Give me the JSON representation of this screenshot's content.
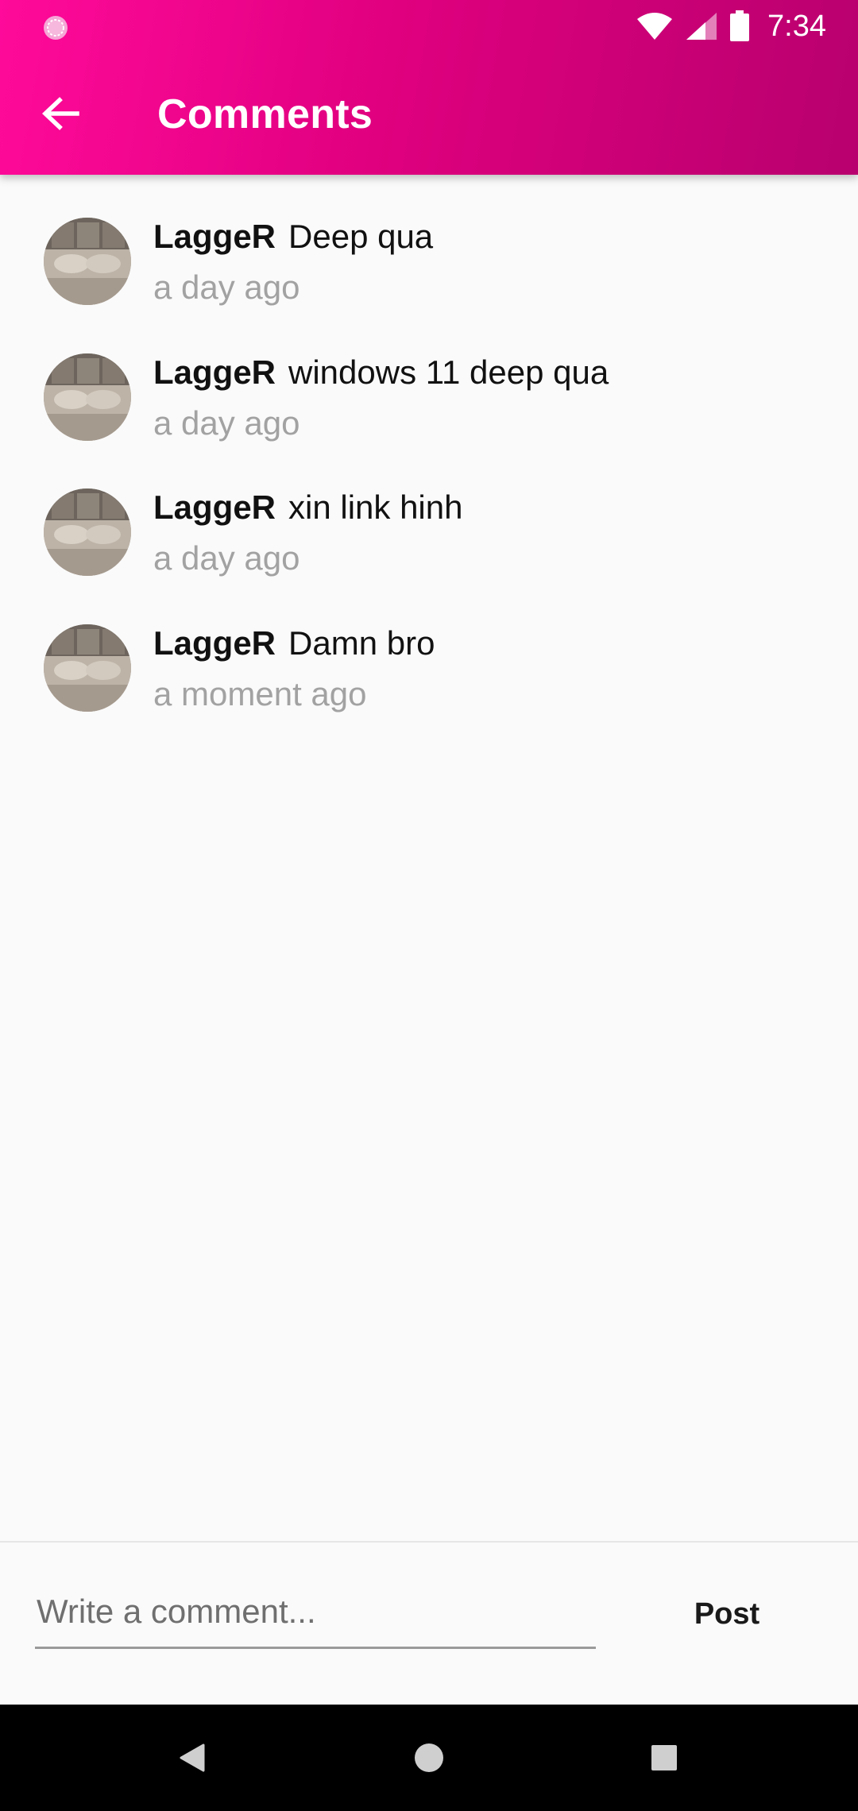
{
  "status_bar": {
    "time": "7:34",
    "icons": [
      "app-notification-icon",
      "wifi-icon",
      "signal-icon",
      "battery-icon"
    ]
  },
  "toolbar": {
    "title": "Comments",
    "back_icon": "arrow-back-icon"
  },
  "comments": [
    {
      "user": "LaggeR",
      "text": "Deep qua",
      "time": "a day ago"
    },
    {
      "user": "LaggeR",
      "text": "windows 11 deep qua",
      "time": "a day ago"
    },
    {
      "user": "LaggeR",
      "text": "xin link hinh",
      "time": "a day ago"
    },
    {
      "user": "LaggeR",
      "text": "Damn bro",
      "time": "a moment ago"
    }
  ],
  "composer": {
    "placeholder": "Write a comment...",
    "value": "",
    "post_label": "Post"
  },
  "nav_bar": {
    "icons": [
      "nav-back-icon",
      "nav-home-icon",
      "nav-recents-icon"
    ]
  },
  "colors": {
    "appbar_start": "#ff0a9a",
    "appbar_end": "#b8006e",
    "timestamp": "#a2a2a2",
    "background": "#fafafa"
  }
}
